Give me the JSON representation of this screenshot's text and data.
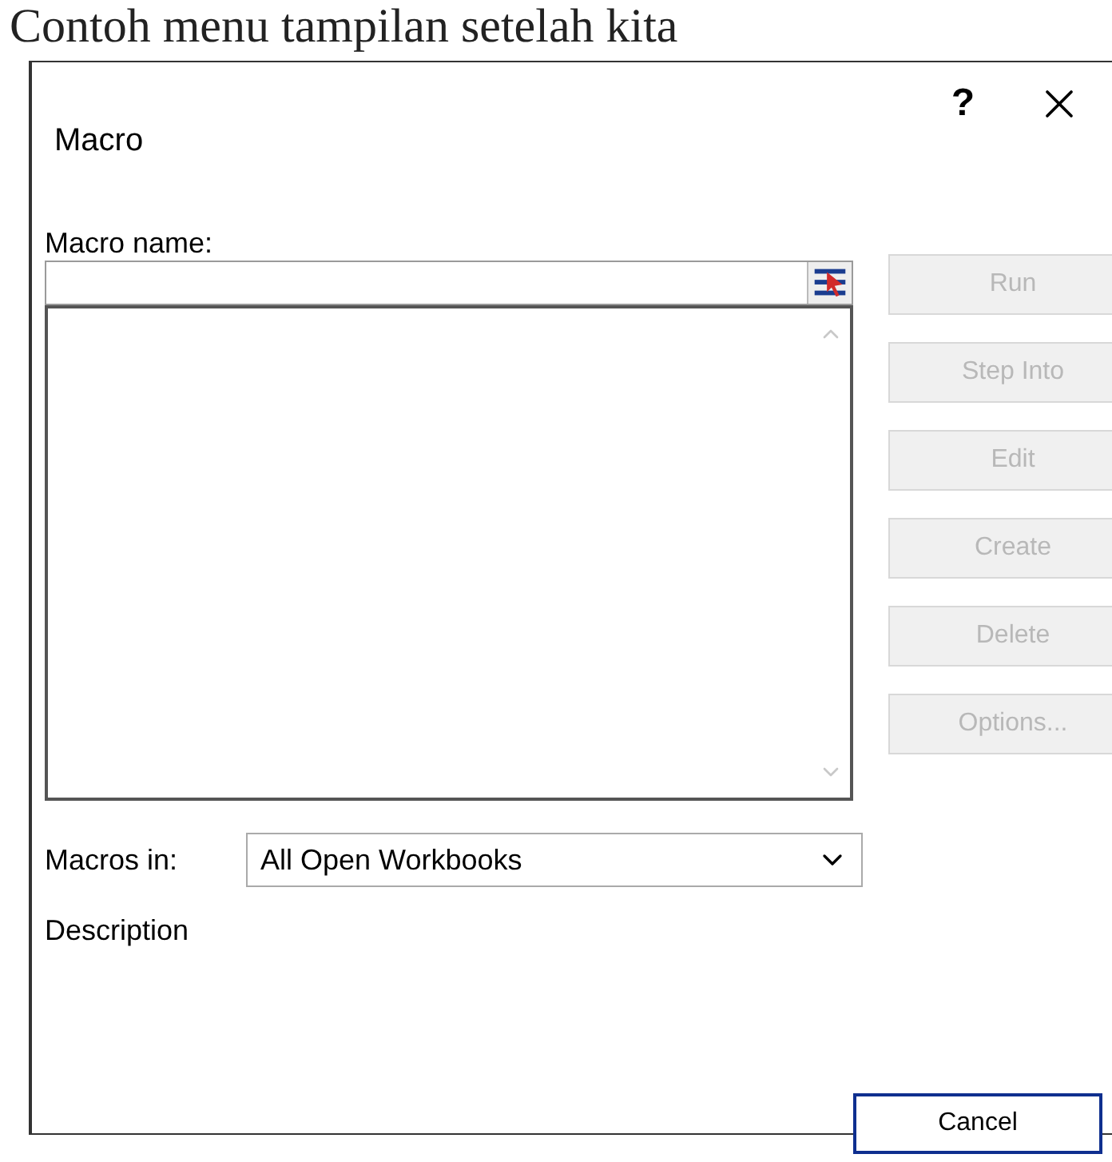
{
  "caption": "Contoh menu tampilan setelah kita",
  "window": {
    "title": "Macro",
    "help_glyph": "?"
  },
  "macro_name": {
    "label": "Macro name:"
  },
  "buttons": [
    {
      "label": "Run",
      "disabled": true,
      "focused": false
    },
    {
      "label": "Step Into",
      "disabled": true,
      "focused": false
    },
    {
      "label": "Edit",
      "disabled": true,
      "focused": false
    },
    {
      "label": "Create",
      "disabled": true,
      "focused": false
    },
    {
      "label": "Delete",
      "disabled": true,
      "focused": false
    },
    {
      "label": "Options...",
      "disabled": true,
      "focused": false
    }
  ],
  "macros_in": {
    "label": "Macros in:",
    "value": "All Open Workbooks"
  },
  "description": {
    "label": "Description"
  },
  "cancel": {
    "label": "Cancel",
    "disabled": false,
    "focused": true
  }
}
